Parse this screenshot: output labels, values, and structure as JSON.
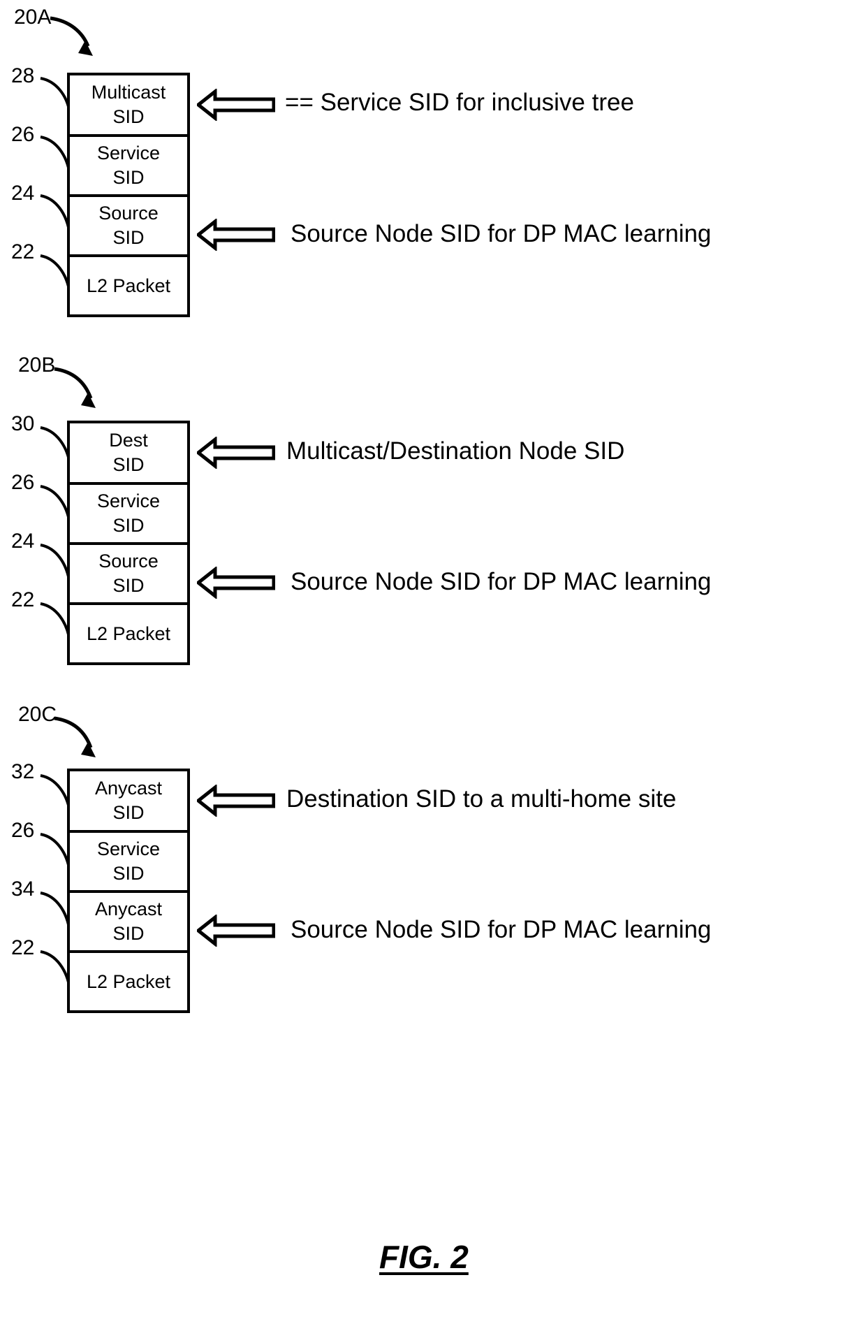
{
  "figure": {
    "caption": "FIG. 2"
  },
  "blocks": [
    {
      "id": "20A",
      "tag": "20A",
      "rows": [
        {
          "ref": "28",
          "line1": "Multicast",
          "line2": "SID"
        },
        {
          "ref": "26",
          "line1": "Service",
          "line2": "SID"
        },
        {
          "ref": "24",
          "line1": "Source",
          "line2": "SID"
        },
        {
          "ref": "22",
          "line1": "L2 Packet",
          "line2": ""
        }
      ],
      "annotations": [
        {
          "target_row": 0,
          "text": "== Service SID for inclusive tree"
        },
        {
          "target_row": 2,
          "text": "Source Node SID for DP MAC learning"
        }
      ]
    },
    {
      "id": "20B",
      "tag": "20B",
      "rows": [
        {
          "ref": "30",
          "line1": "Dest",
          "line2": "SID"
        },
        {
          "ref": "26",
          "line1": "Service",
          "line2": "SID"
        },
        {
          "ref": "24",
          "line1": "Source",
          "line2": "SID"
        },
        {
          "ref": "22",
          "line1": "L2 Packet",
          "line2": ""
        }
      ],
      "annotations": [
        {
          "target_row": 0,
          "text": "Multicast/Destination Node SID"
        },
        {
          "target_row": 2,
          "text": "Source Node SID for DP MAC learning"
        }
      ]
    },
    {
      "id": "20C",
      "tag": "20C",
      "rows": [
        {
          "ref": "32",
          "line1": "Anycast",
          "line2": "SID"
        },
        {
          "ref": "26",
          "line1": "Service",
          "line2": "SID"
        },
        {
          "ref": "34",
          "line1": "Anycast",
          "line2": "SID"
        },
        {
          "ref": "22",
          "line1": "L2 Packet",
          "line2": ""
        }
      ],
      "annotations": [
        {
          "target_row": 0,
          "text": "Destination SID to a multi-home site"
        },
        {
          "target_row": 2,
          "text": "Source Node SID for DP MAC learning"
        }
      ]
    }
  ],
  "colors": {
    "ink": "#000000",
    "paper": "#ffffff"
  }
}
